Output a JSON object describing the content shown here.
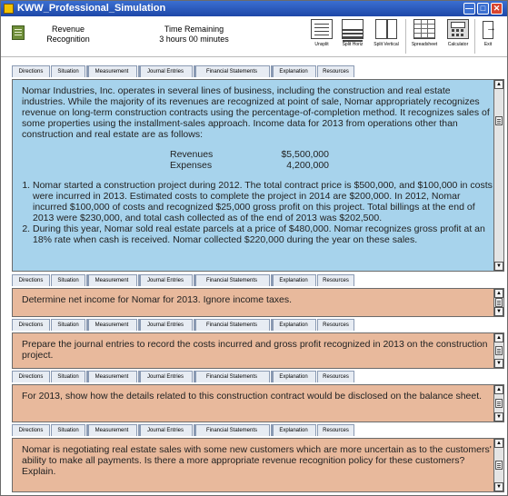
{
  "window": {
    "title": "KWW_Professional_Simulation"
  },
  "header": {
    "task_title": "Revenue Recognition",
    "time_label": "Time Remaining",
    "time_value": "3 hours 00 minutes"
  },
  "toolbar": {
    "unsplit": "Unsplit",
    "split_horiz": "Split Horiz",
    "split_vertical": "Split Vertical",
    "spreadsheet": "Spreadsheet",
    "calculator": "Calculator",
    "exit": "Exit"
  },
  "tabs": [
    "Directions",
    "Situation",
    "Measurement",
    "Journal Entries",
    "Financial Statements",
    "Explanation",
    "Resources"
  ],
  "situation": {
    "paragraph": "Nomar Industries, Inc. operates in several lines of business, including the construction and real estate industries. While the majority of its revenues are recognized at point of sale, Nomar appropriately recognizes revenue on long-term construction contracts using the percentage-of-completion method. It recognizes sales of some properties using the installment-sales approach. Income data for 2013 from operations other than construction and real estate are as follows:",
    "income": [
      {
        "label": "Revenues",
        "value": "$5,500,000"
      },
      {
        "label": "Expenses",
        "value": "4,200,000"
      }
    ],
    "items": [
      "Nomar started a construction project during 2012. The total contract price is $500,000, and $100,000 in costs were incurred in 2013. Estimated costs to complete the project in 2014 are $200,000. In 2012, Nomar incurred $100,000 of costs and recognized $25,000 gross profit on this project. Total billings at the end of 2013 were $230,000, and total cash collected as of the end of 2013 was $202,500.",
      "During this year, Nomar sold real estate parcels at a price of $480,000. Nomar recognizes gross profit at an 18% rate when cash is received. Nomar collected $220,000 during the year on these sales."
    ]
  },
  "measurement": {
    "text": "Determine net income for Nomar for 2013. Ignore income taxes."
  },
  "journal_entries": {
    "text": "Prepare the journal entries to record the costs incurred and gross profit recognized in 2013 on the construction project."
  },
  "financial_statements": {
    "text": "For 2013, show how the details related to this construction contract would be disclosed on the balance sheet."
  },
  "explanation": {
    "text": "Nomar is negotiating real estate sales with some new customers which are more uncertain as to the customers' ability to make all payments. Is there a more appropriate revenue recognition policy for these customers? Explain."
  },
  "colors": {
    "situation_panel": "#a7d3ec",
    "task_panel": "#e8b99c",
    "titlebar": "#1d47a8"
  }
}
